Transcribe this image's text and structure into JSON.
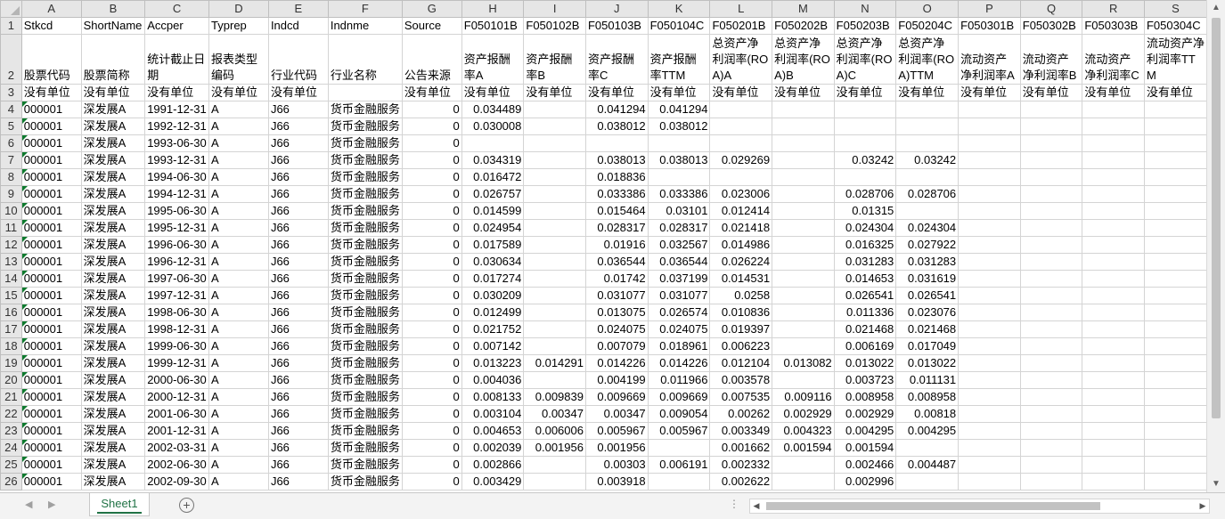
{
  "columns": [
    "A",
    "B",
    "C",
    "D",
    "E",
    "F",
    "G",
    "H",
    "I",
    "J",
    "K",
    "L",
    "M",
    "N",
    "O",
    "P",
    "Q",
    "R",
    "S"
  ],
  "row1": [
    "Stkcd",
    "ShortName",
    "Accper",
    "Typrep",
    "Indcd",
    "Indnme",
    "Source",
    "F050101B",
    "F050102B",
    "F050103B",
    "F050104C",
    "F050201B",
    "F050202B",
    "F050203B",
    "F050204C",
    "F050301B",
    "F050302B",
    "F050303B",
    "F050304C"
  ],
  "row2": [
    "股票代码",
    "股票简称",
    "统计截止日期",
    "报表类型编码",
    "行业代码",
    "行业名称",
    "公告来源",
    "资产报酬率A",
    "资产报酬率B",
    "资产报酬率C",
    "资产报酬率TTM",
    "总资产净利润率(ROA)A",
    "总资产净利润率(ROA)B",
    "总资产净利润率(ROA)C",
    "总资产净利润率(ROA)TTM",
    "流动资产净利润率A",
    "流动资产净利润率B",
    "流动资产净利润率C",
    "流动资产净利润率TTM"
  ],
  "row3": [
    "没有单位",
    "没有单位",
    "没有单位",
    "没有单位",
    "没有单位",
    "",
    "没有单位",
    "没有单位",
    "没有单位",
    "没有单位",
    "没有单位",
    "没有单位",
    "没有单位",
    "没有单位",
    "没有单位",
    "没有单位",
    "没有单位",
    "没有单位",
    "没有单位"
  ],
  "rows": [
    [
      "000001",
      "深发展A",
      "1991-12-31",
      "A",
      "J66",
      "货币金融服务",
      "0",
      "0.034489",
      "",
      "0.041294",
      "0.041294",
      "",
      "",
      "",
      "",
      "",
      "",
      "",
      ""
    ],
    [
      "000001",
      "深发展A",
      "1992-12-31",
      "A",
      "J66",
      "货币金融服务",
      "0",
      "0.030008",
      "",
      "0.038012",
      "0.038012",
      "",
      "",
      "",
      "",
      "",
      "",
      "",
      ""
    ],
    [
      "000001",
      "深发展A",
      "1993-06-30",
      "A",
      "J66",
      "货币金融服务",
      "0",
      "",
      "",
      "",
      "",
      "",
      "",
      "",
      "",
      "",
      "",
      "",
      ""
    ],
    [
      "000001",
      "深发展A",
      "1993-12-31",
      "A",
      "J66",
      "货币金融服务",
      "0",
      "0.034319",
      "",
      "0.038013",
      "0.038013",
      "0.029269",
      "",
      "0.03242",
      "0.03242",
      "",
      "",
      "",
      ""
    ],
    [
      "000001",
      "深发展A",
      "1994-06-30",
      "A",
      "J66",
      "货币金融服务",
      "0",
      "0.016472",
      "",
      "0.018836",
      "",
      "",
      "",
      "",
      "",
      "",
      "",
      "",
      ""
    ],
    [
      "000001",
      "深发展A",
      "1994-12-31",
      "A",
      "J66",
      "货币金融服务",
      "0",
      "0.026757",
      "",
      "0.033386",
      "0.033386",
      "0.023006",
      "",
      "0.028706",
      "0.028706",
      "",
      "",
      "",
      ""
    ],
    [
      "000001",
      "深发展A",
      "1995-06-30",
      "A",
      "J66",
      "货币金融服务",
      "0",
      "0.014599",
      "",
      "0.015464",
      "0.03101",
      "0.012414",
      "",
      "0.01315",
      "",
      "",
      "",
      "",
      ""
    ],
    [
      "000001",
      "深发展A",
      "1995-12-31",
      "A",
      "J66",
      "货币金融服务",
      "0",
      "0.024954",
      "",
      "0.028317",
      "0.028317",
      "0.021418",
      "",
      "0.024304",
      "0.024304",
      "",
      "",
      "",
      ""
    ],
    [
      "000001",
      "深发展A",
      "1996-06-30",
      "A",
      "J66",
      "货币金融服务",
      "0",
      "0.017589",
      "",
      "0.01916",
      "0.032567",
      "0.014986",
      "",
      "0.016325",
      "0.027922",
      "",
      "",
      "",
      ""
    ],
    [
      "000001",
      "深发展A",
      "1996-12-31",
      "A",
      "J66",
      "货币金融服务",
      "0",
      "0.030634",
      "",
      "0.036544",
      "0.036544",
      "0.026224",
      "",
      "0.031283",
      "0.031283",
      "",
      "",
      "",
      ""
    ],
    [
      "000001",
      "深发展A",
      "1997-06-30",
      "A",
      "J66",
      "货币金融服务",
      "0",
      "0.017274",
      "",
      "0.01742",
      "0.037199",
      "0.014531",
      "",
      "0.014653",
      "0.031619",
      "",
      "",
      "",
      ""
    ],
    [
      "000001",
      "深发展A",
      "1997-12-31",
      "A",
      "J66",
      "货币金融服务",
      "0",
      "0.030209",
      "",
      "0.031077",
      "0.031077",
      "0.0258",
      "",
      "0.026541",
      "0.026541",
      "",
      "",
      "",
      ""
    ],
    [
      "000001",
      "深发展A",
      "1998-06-30",
      "A",
      "J66",
      "货币金融服务",
      "0",
      "0.012499",
      "",
      "0.013075",
      "0.026574",
      "0.010836",
      "",
      "0.011336",
      "0.023076",
      "",
      "",
      "",
      ""
    ],
    [
      "000001",
      "深发展A",
      "1998-12-31",
      "A",
      "J66",
      "货币金融服务",
      "0",
      "0.021752",
      "",
      "0.024075",
      "0.024075",
      "0.019397",
      "",
      "0.021468",
      "0.021468",
      "",
      "",
      "",
      ""
    ],
    [
      "000001",
      "深发展A",
      "1999-06-30",
      "A",
      "J66",
      "货币金融服务",
      "0",
      "0.007142",
      "",
      "0.007079",
      "0.018961",
      "0.006223",
      "",
      "0.006169",
      "0.017049",
      "",
      "",
      "",
      ""
    ],
    [
      "000001",
      "深发展A",
      "1999-12-31",
      "A",
      "J66",
      "货币金融服务",
      "0",
      "0.013223",
      "0.014291",
      "0.014226",
      "0.014226",
      "0.012104",
      "0.013082",
      "0.013022",
      "0.013022",
      "",
      "",
      "",
      ""
    ],
    [
      "000001",
      "深发展A",
      "2000-06-30",
      "A",
      "J66",
      "货币金融服务",
      "0",
      "0.004036",
      "",
      "0.004199",
      "0.011966",
      "0.003578",
      "",
      "0.003723",
      "0.011131",
      "",
      "",
      "",
      ""
    ],
    [
      "000001",
      "深发展A",
      "2000-12-31",
      "A",
      "J66",
      "货币金融服务",
      "0",
      "0.008133",
      "0.009839",
      "0.009669",
      "0.009669",
      "0.007535",
      "0.009116",
      "0.008958",
      "0.008958",
      "",
      "",
      "",
      ""
    ],
    [
      "000001",
      "深发展A",
      "2001-06-30",
      "A",
      "J66",
      "货币金融服务",
      "0",
      "0.003104",
      "0.00347",
      "0.00347",
      "0.009054",
      "0.00262",
      "0.002929",
      "0.002929",
      "0.00818",
      "",
      "",
      "",
      ""
    ],
    [
      "000001",
      "深发展A",
      "2001-12-31",
      "A",
      "J66",
      "货币金融服务",
      "0",
      "0.004653",
      "0.006006",
      "0.005967",
      "0.005967",
      "0.003349",
      "0.004323",
      "0.004295",
      "0.004295",
      "",
      "",
      "",
      ""
    ],
    [
      "000001",
      "深发展A",
      "2002-03-31",
      "A",
      "J66",
      "货币金融服务",
      "0",
      "0.002039",
      "0.001956",
      "0.001956",
      "",
      "0.001662",
      "0.001594",
      "0.001594",
      "",
      "",
      "",
      "",
      ""
    ],
    [
      "000001",
      "深发展A",
      "2002-06-30",
      "A",
      "J66",
      "货币金融服务",
      "0",
      "0.002866",
      "",
      "0.00303",
      "0.006191",
      "0.002332",
      "",
      "0.002466",
      "0.004487",
      "",
      "",
      "",
      ""
    ],
    [
      "000001",
      "深发展A",
      "2002-09-30",
      "A",
      "J66",
      "货币金融服务",
      "0",
      "0.003429",
      "",
      "0.003918",
      "",
      "0.002622",
      "",
      "0.002996",
      "",
      "",
      "",
      "",
      ""
    ]
  ],
  "sheet_tab": "Sheet1"
}
